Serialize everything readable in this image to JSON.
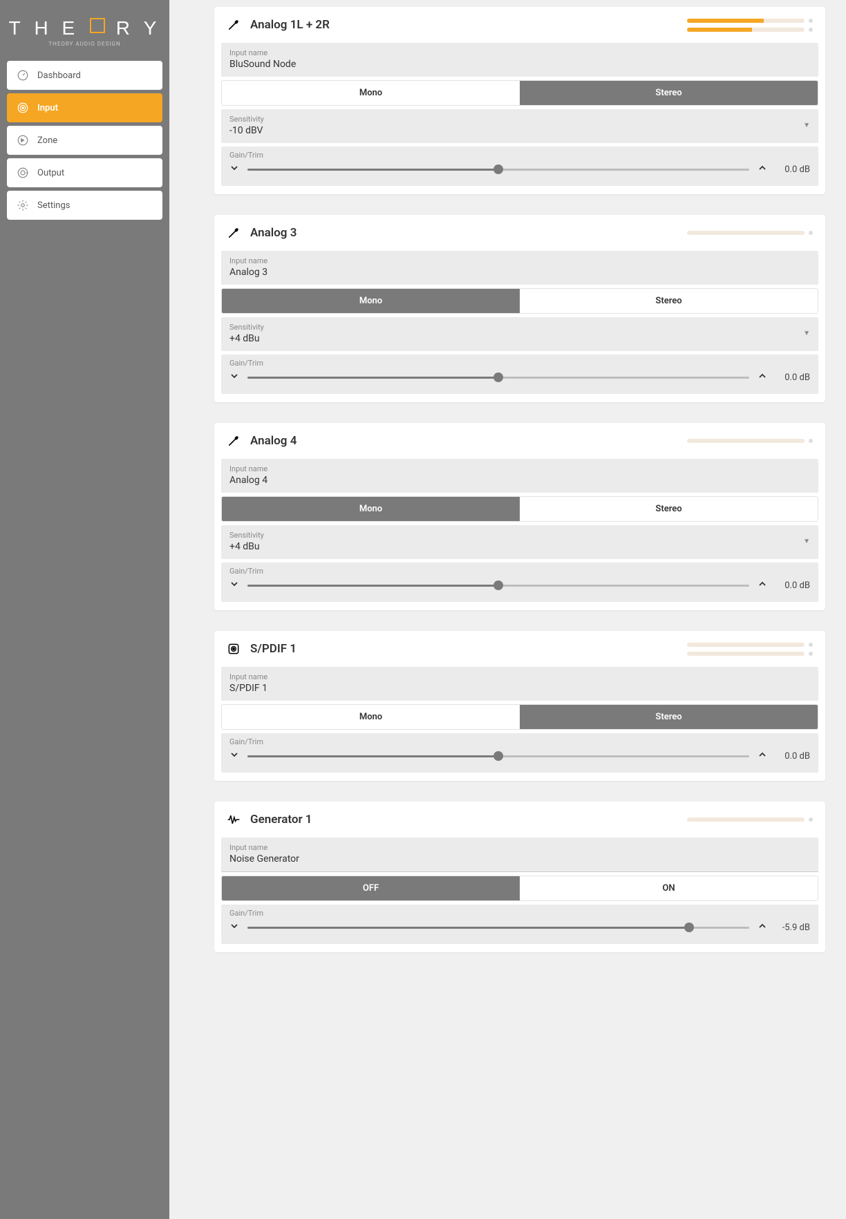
{
  "brand": {
    "name": "THEORY",
    "tagline": "THEORY AUDIO DESIGN"
  },
  "nav": [
    {
      "icon": "gauge",
      "label": "Dashboard",
      "active": false
    },
    {
      "icon": "target",
      "label": "Input",
      "active": true
    },
    {
      "icon": "speaker",
      "label": "Zone",
      "active": false
    },
    {
      "icon": "output",
      "label": "Output",
      "active": false
    },
    {
      "icon": "gear",
      "label": "Settings",
      "active": false
    }
  ],
  "labels": {
    "input_name": "Input name",
    "sensitivity": "Sensitivity",
    "gain_trim": "Gain/Trim",
    "mono": "Mono",
    "stereo": "Stereo",
    "off": "OFF",
    "on": "ON"
  },
  "inputs": [
    {
      "icon": "jack",
      "title": "Analog 1L + 2R",
      "meters": [
        65,
        55
      ],
      "name": "BluSound Node",
      "mode": {
        "options": [
          "Mono",
          "Stereo"
        ],
        "active": "Stereo"
      },
      "sensitivity": "-10 dBV",
      "gain": {
        "value": "0.0 dB",
        "percent": 50
      }
    },
    {
      "icon": "jack",
      "title": "Analog 3",
      "meters": [
        0
      ],
      "name": "Analog 3",
      "mode": {
        "options": [
          "Mono",
          "Stereo"
        ],
        "active": "Mono"
      },
      "sensitivity": "+4 dBu",
      "gain": {
        "value": "0.0 dB",
        "percent": 50
      }
    },
    {
      "icon": "jack",
      "title": "Analog 4",
      "meters": [
        0
      ],
      "name": "Analog 4",
      "mode": {
        "options": [
          "Mono",
          "Stereo"
        ],
        "active": "Mono"
      },
      "sensitivity": "+4 dBu",
      "gain": {
        "value": "0.0 dB",
        "percent": 50
      }
    },
    {
      "icon": "spdif",
      "title": "S/PDIF 1",
      "meters": [
        0,
        0
      ],
      "name": "S/PDIF 1",
      "mode": {
        "options": [
          "Mono",
          "Stereo"
        ],
        "active": "Stereo"
      },
      "sensitivity": null,
      "gain": {
        "value": "0.0 dB",
        "percent": 50
      }
    },
    {
      "icon": "wave",
      "title": "Generator 1",
      "meters": [
        0
      ],
      "name": "Noise Generator",
      "name_dotted": true,
      "power": {
        "options": [
          "OFF",
          "ON"
        ],
        "active": "OFF"
      },
      "sensitivity": null,
      "gain": {
        "value": "-5.9 dB",
        "percent": 88
      }
    }
  ]
}
